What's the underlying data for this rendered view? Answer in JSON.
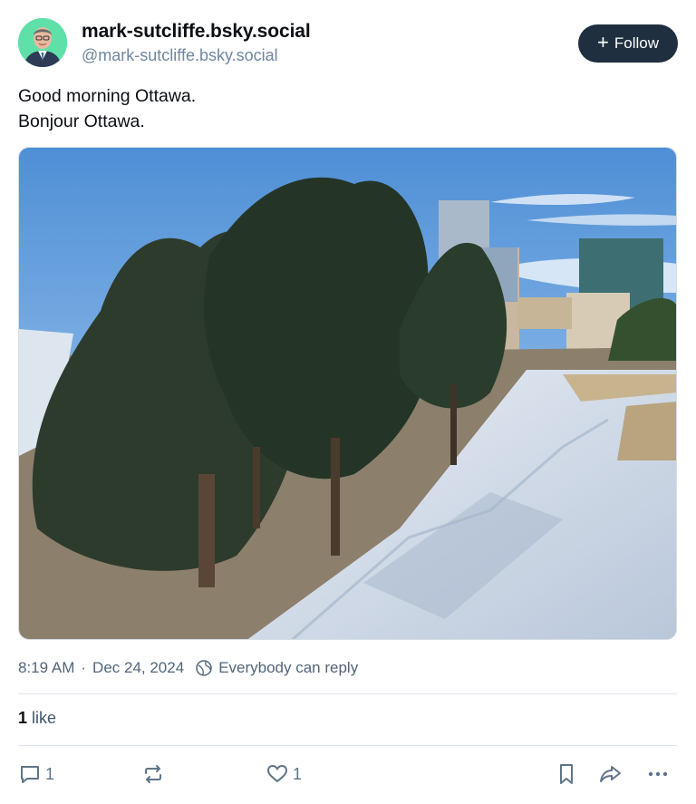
{
  "author": {
    "display_name": "mark-sutcliffe.bsky.social",
    "handle": "@mark-sutcliffe.bsky.social",
    "avatar_icon": "person-avatar"
  },
  "follow_button": {
    "label": "Follow",
    "icon": "plus-icon"
  },
  "post": {
    "lines": [
      "Good morning Ottawa.",
      "Bonjour Ottawa."
    ],
    "image_icon": "snowy-park-photo"
  },
  "meta": {
    "time": "8:19 AM",
    "separator": "·",
    "date": "Dec 24, 2024",
    "reply_setting": "Everybody can reply"
  },
  "stats": {
    "likes_count": "1",
    "likes_label": "like"
  },
  "actions": {
    "reply_count": "1",
    "repost_count": "",
    "like_count": "1"
  },
  "colors": {
    "follow_bg": "#1f2f3f",
    "muted_text": "#6f869f",
    "avatar_bg": "#5fe0a8"
  }
}
